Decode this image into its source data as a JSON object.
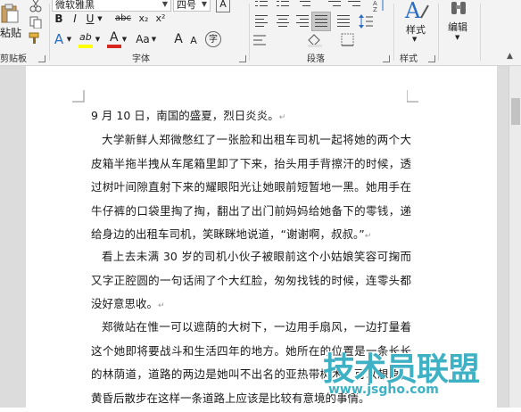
{
  "ribbon": {
    "clipboard": {
      "paste_label": "粘贴",
      "group_label": "剪贴板"
    },
    "font": {
      "font_name": "微软雅黑",
      "font_size": "四号",
      "bold": "B",
      "italic": "I",
      "underline": "U",
      "strike": "abc",
      "subscript": "x₂",
      "superscript": "x²",
      "text_effects": "A",
      "highlight": "ab",
      "font_color": "A",
      "change_case": "Aa",
      "grow": "A",
      "shrink": "A",
      "enclose": "字",
      "group_label": "字体"
    },
    "paragraph": {
      "group_label": "段落"
    },
    "styles": {
      "label": "样式",
      "group_label": "样式"
    },
    "editing": {
      "label": "编辑"
    },
    "colors": {
      "font_color_bar": "#d6261e",
      "highlight_bar": "#ffff00",
      "text_effects_color": "#2b6cc4"
    }
  },
  "document": {
    "paragraphs": [
      {
        "text": "9 月 10 日，南国的盛夏，烈日炎炎。",
        "mark": "↵"
      },
      {
        "text": "大学新鲜人郑微憋红了一张脸和出租车司机一起将她的两个大皮箱半拖半拽从车尾箱里卸了下来，抬头用手背擦汗的时候，透过树叶间隙直射下来的耀眼阳光让她眼前短暂地一黑。她用手在牛仔裤的口袋里掏了掏，翻出了出门前妈妈给她备下的零钱，递给身边的出租车司机，笑眯眯地说道，“谢谢啊，叔叔。”",
        "mark": "↵"
      },
      {
        "text": "看上去未满 30 岁的司机小伙子被眼前这个小姑娘笑容可掬而又字正腔圆的一句话闹了个大红脸，匆匆找钱的时候，连零头都没好意思收。",
        "mark": "↵"
      },
      {
        "text": "郑微站在惟一可以遮荫的大树下，一边用手扇风，一边打量着这个她即将要战斗和生活四年的地方。她所在的位置是一条长长的林荫道，道路的两边是她叫不出名的亚热带树木，可以想象，黄昏后散步在这样一条道路上应该是比较有意境的事情。",
        "mark": ""
      }
    ]
  },
  "watermark": {
    "title": "技术员联盟",
    "url": "www.jsgho.com"
  }
}
